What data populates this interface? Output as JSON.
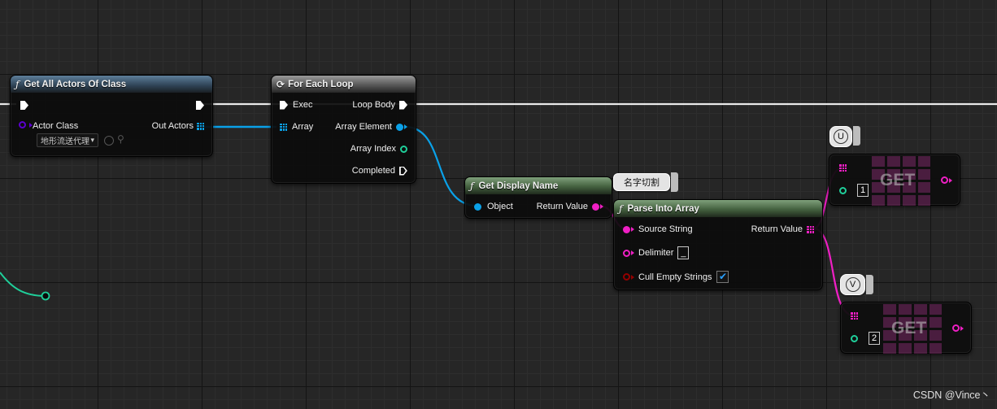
{
  "nodes": {
    "get_all_actors": {
      "title": "Get All Actors Of Class",
      "actor_class_label": "Actor Class",
      "actor_class_value": "地形流送代理",
      "out_actors_label": "Out Actors"
    },
    "for_each_loop": {
      "title": "For Each Loop",
      "exec_label": "Exec",
      "array_label": "Array",
      "loop_body_label": "Loop Body",
      "array_element_label": "Array Element",
      "array_index_label": "Array Index",
      "completed_label": "Completed"
    },
    "get_display_name": {
      "title": "Get Display Name",
      "object_label": "Object",
      "return_value_label": "Return Value"
    },
    "parse_into_array": {
      "comment": "名字切割",
      "title": "Parse Into Array",
      "source_string_label": "Source String",
      "delimiter_label": "Delimiter",
      "delimiter_value": "_",
      "cull_empty_label": "Cull Empty Strings",
      "cull_empty_checked": true,
      "return_value_label": "Return Value"
    },
    "get_u": {
      "comment": "U",
      "label": "GET",
      "index_value": "1"
    },
    "get_v": {
      "comment": "V",
      "label": "GET",
      "index_value": "2"
    }
  },
  "colors": {
    "exec_wire": "#ffffff",
    "object_wire": "#0aa1e8",
    "string_wire": "#ef1fc4",
    "int_wire": "#1fcf9a",
    "bool_pin": "#950000",
    "class_pin": "#5b00d0"
  },
  "watermark": "CSDN @Vince丶"
}
